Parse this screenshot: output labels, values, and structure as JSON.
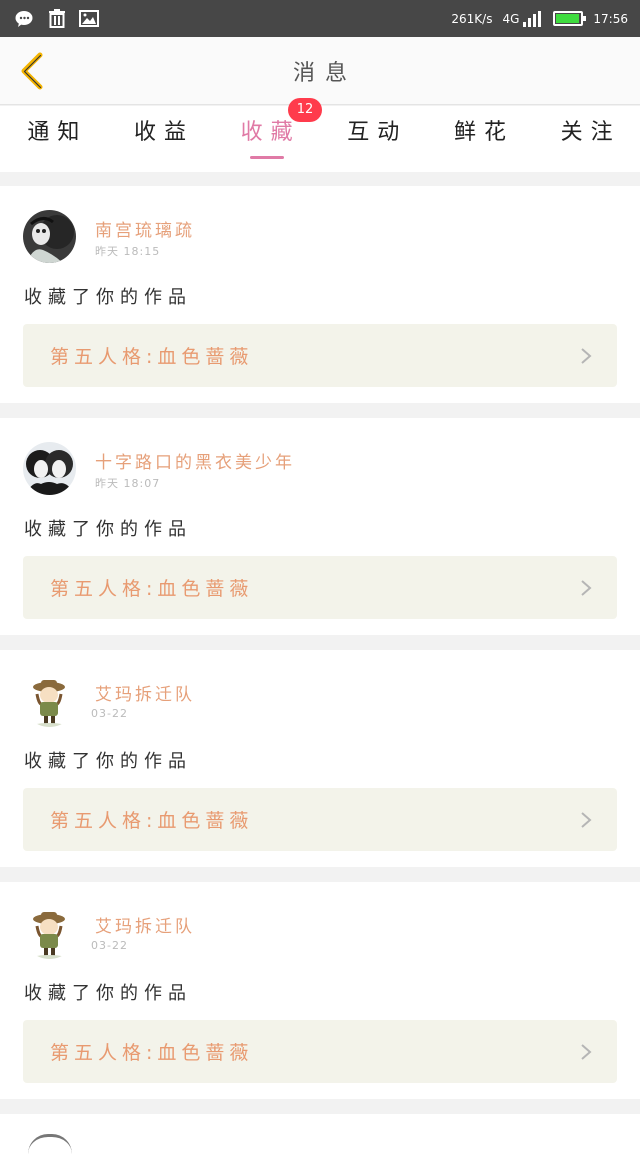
{
  "status_bar": {
    "net_speed": "261K/s",
    "network": "4G",
    "time": "17:56",
    "battery_level": 0.95,
    "icons": [
      "wechat-icon",
      "trash-icon",
      "image-icon",
      "signal-icon",
      "battery-icon"
    ]
  },
  "header": {
    "title": "消息",
    "back_icon": "chevron-left-icon"
  },
  "tabs": [
    {
      "label": "通知",
      "active": false
    },
    {
      "label": "收益",
      "active": false
    },
    {
      "label": "收藏",
      "active": true,
      "badge": "12"
    },
    {
      "label": "互动",
      "active": false
    },
    {
      "label": "鲜花",
      "active": false
    },
    {
      "label": "关注",
      "active": false
    }
  ],
  "colors": {
    "accent": "#e07aa6",
    "badge": "#ff3b4c",
    "name": "#e6a07a",
    "work_title": "#e89a70",
    "work_bg": "#f3f3ea"
  },
  "notifications": [
    {
      "user": "南宫琉璃疏",
      "time": "昨天 18:15",
      "action": "收藏了你的作品",
      "work": "第五人格:血色蔷薇"
    },
    {
      "user": "十字路口的黑衣美少年",
      "time": "昨天 18:07",
      "action": "收藏了你的作品",
      "work": "第五人格:血色蔷薇"
    },
    {
      "user": "艾玛拆迁队",
      "time": "03-22",
      "action": "收藏了你的作品",
      "work": "第五人格:血色蔷薇"
    },
    {
      "user": "艾玛拆迁队",
      "time": "03-22",
      "action": "收藏了你的作品",
      "work": "第五人格:血色蔷薇"
    }
  ]
}
